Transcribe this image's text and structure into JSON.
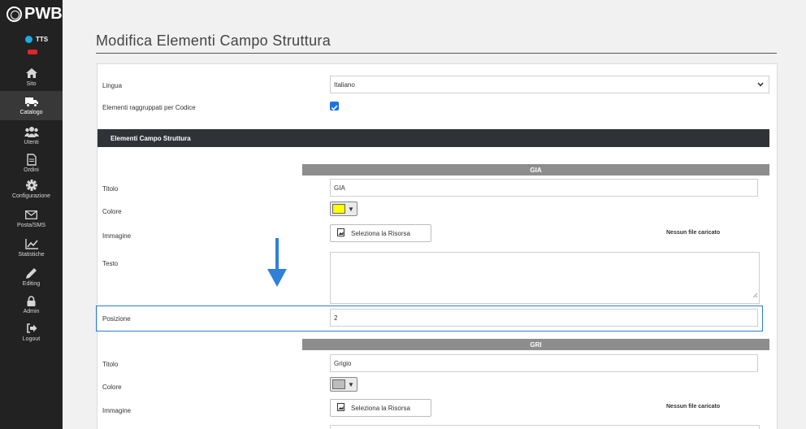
{
  "brand": {
    "name": "PWB"
  },
  "status": {
    "label": "TTS"
  },
  "colors": {
    "accent": "#1a73e8",
    "sidebar": "#222222",
    "section": "#2f3338",
    "group": "#8d8d8d",
    "yellow": "#ffff00",
    "grey": "#bdbdbd"
  },
  "sidebar": {
    "items": [
      {
        "label": "Sito",
        "icon": "home-icon"
      },
      {
        "label": "Catalogo",
        "icon": "truck-icon"
      },
      {
        "label": "Utenti",
        "icon": "users-icon"
      },
      {
        "label": "Ordini",
        "icon": "document-icon"
      },
      {
        "label": "Configurazione",
        "icon": "gear-icon"
      },
      {
        "label": "Posta/SMS",
        "icon": "envelope-icon"
      },
      {
        "label": "Statistiche",
        "icon": "chart-icon"
      },
      {
        "label": "Editing",
        "icon": "pencil-icon"
      },
      {
        "label": "Admin",
        "icon": "lock-icon"
      },
      {
        "label": "Logout",
        "icon": "logout-icon"
      }
    ]
  },
  "page": {
    "title": "Modifica Elementi Campo Struttura"
  },
  "form": {
    "lingua_label": "Lingua",
    "lingua_value": "Italiano",
    "grouped_label": "Elementi raggruppati per Codice",
    "section_title": "Elementi Campo Struttura"
  },
  "groups": [
    {
      "code": "GIA",
      "titolo_label": "Titolo",
      "titolo_value": "GIA",
      "colore_label": "Colore",
      "immagine_label": "Immagine",
      "resource_button": "Seleziona la Risorsa",
      "no_file": "Nessun file caricato",
      "testo_label": "Testo",
      "posizione_label": "Posizione",
      "posizione_value": "2"
    },
    {
      "code": "GRI",
      "titolo_label": "Titolo",
      "titolo_value": "Grigio",
      "colore_label": "Colore",
      "immagine_label": "Immagine",
      "resource_button": "Seleziona la Risorsa",
      "no_file": "Nessun file caricato"
    }
  ]
}
